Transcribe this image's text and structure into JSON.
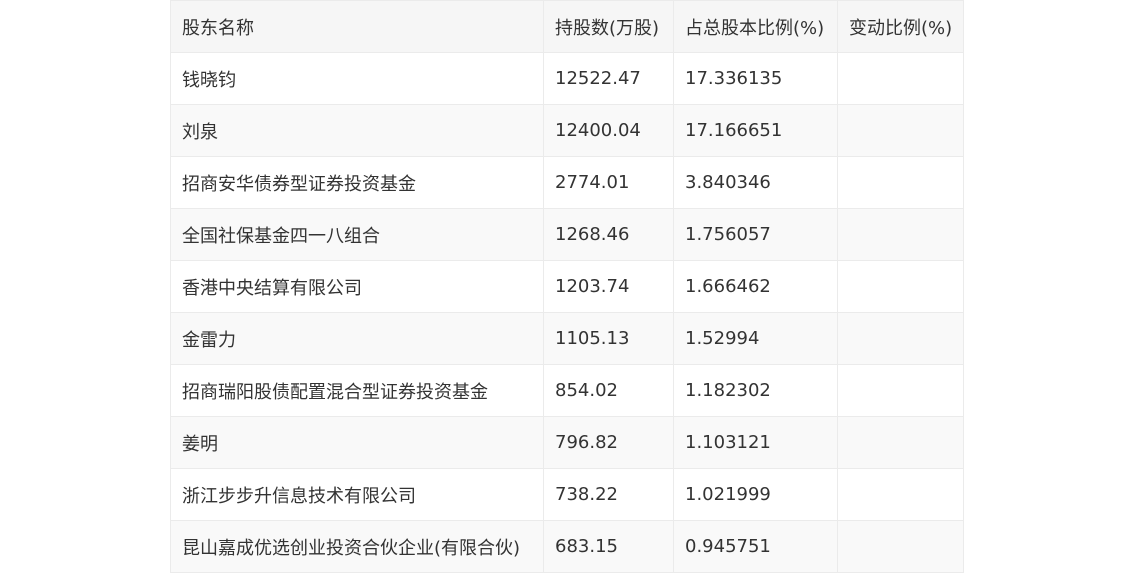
{
  "table": {
    "headers": [
      "股东名称",
      "持股数(万股)",
      "占总股本比例(%)",
      "变动比例(%)"
    ],
    "rows": [
      [
        "钱晓钧",
        "12522.47",
        "17.336135",
        ""
      ],
      [
        "刘泉",
        "12400.04",
        "17.166651",
        ""
      ],
      [
        "招商安华债券型证券投资基金",
        "2774.01",
        "3.840346",
        ""
      ],
      [
        "全国社保基金四一八组合",
        "1268.46",
        "1.756057",
        ""
      ],
      [
        "香港中央结算有限公司",
        "1203.74",
        "1.666462",
        ""
      ],
      [
        "金雷力",
        "1105.13",
        "1.52994",
        ""
      ],
      [
        "招商瑞阳股债配置混合型证券投资基金",
        "854.02",
        "1.182302",
        ""
      ],
      [
        "姜明",
        "796.82",
        "1.103121",
        ""
      ],
      [
        "浙江步步升信息技术有限公司",
        "738.22",
        "1.021999",
        ""
      ],
      [
        "昆山嘉成优选创业投资合伙企业(有限合伙)",
        "683.15",
        "0.945751",
        ""
      ]
    ]
  }
}
